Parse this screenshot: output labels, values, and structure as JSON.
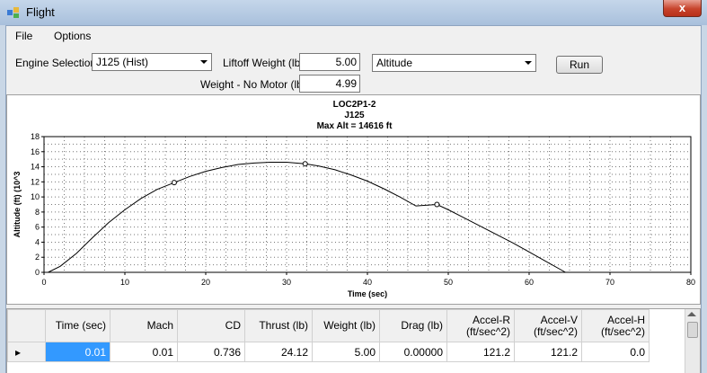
{
  "window": {
    "title": "Flight",
    "close_glyph": "x"
  },
  "menu": {
    "file": "File",
    "options": "Options"
  },
  "controls": {
    "engine_label": "Engine Selection",
    "engine_value": "J125  (Hist)",
    "liftoff_label": "Liftoff Weight (lb)",
    "liftoff_value": "5.00",
    "nomotor_label": "Weight - No Motor (lb)",
    "nomotor_value": "4.99",
    "plot_value": "Altitude",
    "run_label": "Run"
  },
  "chart_data": {
    "type": "line",
    "title": "LOC2P1-2",
    "subtitle": "J125",
    "subtitle2": "Max Alt = 14616 ft",
    "xlabel": "Time (sec)",
    "ylabel": "Altitude (ft) (10^3",
    "xlim": [
      0,
      80
    ],
    "ylim": [
      0,
      18
    ],
    "xticks": [
      "0",
      "10",
      "20",
      "30",
      "40",
      "50",
      "60",
      "70",
      "80"
    ],
    "yticks": [
      "0",
      "2",
      "4",
      "6",
      "8",
      "10",
      "12",
      "14",
      "16",
      "18"
    ],
    "grid": true,
    "series": [
      {
        "x": [
          0.5,
          2,
          4,
          6,
          8,
          10,
          12,
          14,
          16.1,
          18,
          20,
          22,
          24,
          26,
          28,
          30,
          32.3,
          34,
          36,
          38,
          40,
          42,
          44,
          46,
          48.6,
          50,
          52,
          54,
          56,
          58,
          60,
          62,
          64.5
        ],
        "y": [
          0,
          0.8,
          2.5,
          4.6,
          6.6,
          8.3,
          9.8,
          11.0,
          11.9,
          12.7,
          13.4,
          13.9,
          14.3,
          14.5,
          14.6,
          14.6,
          14.4,
          14.1,
          13.6,
          12.9,
          12.1,
          11.1,
          10.0,
          8.8,
          9.0,
          8.3,
          7.2,
          6.1,
          5.0,
          3.9,
          2.7,
          1.5,
          0
        ],
        "markers_x": [
          16.1,
          32.3,
          48.6
        ],
        "markers_y": [
          11.9,
          14.4,
          9.0
        ]
      }
    ]
  },
  "table": {
    "headers": [
      "Time (sec)",
      "Mach",
      "CD",
      "Thrust (lb)",
      "Weight (lb)",
      "Drag (lb)",
      "Accel-R (ft/sec^2)",
      "Accel-V (ft/sec^2)",
      "Accel-H (ft/sec^2)"
    ],
    "rows": [
      [
        "0.01",
        "0.01",
        "0.736",
        "24.12",
        "5.00",
        "0.00000",
        "121.2",
        "121.2",
        "0.0"
      ]
    ]
  }
}
